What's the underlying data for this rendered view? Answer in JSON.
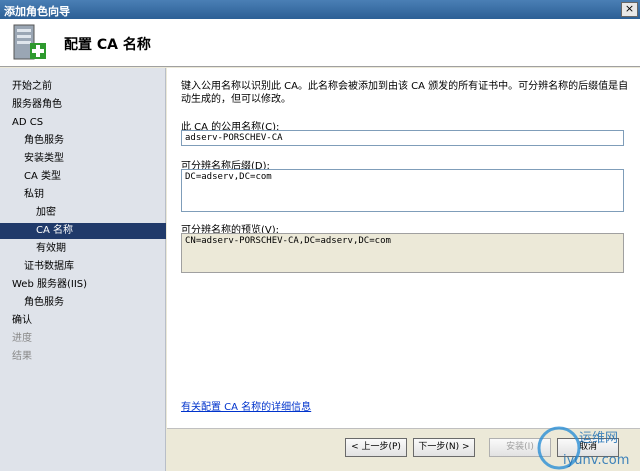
{
  "window": {
    "title": "添加角色向导",
    "close_label": "×"
  },
  "header": {
    "title": "配置 CA 名称",
    "icon": "server-certificate-icon"
  },
  "sidebar": {
    "items": [
      {
        "label": "开始之前",
        "state": "normal"
      },
      {
        "label": "服务器角色",
        "state": "normal"
      },
      {
        "label": "AD CS",
        "state": "normal"
      },
      {
        "label": "角色服务",
        "state": "normal"
      },
      {
        "label": "安装类型",
        "state": "normal"
      },
      {
        "label": "CA 类型",
        "state": "normal"
      },
      {
        "label": "私钥",
        "state": "normal"
      },
      {
        "label": "加密",
        "state": "normal"
      },
      {
        "label": "CA 名称",
        "state": "selected"
      },
      {
        "label": "有效期",
        "state": "normal"
      },
      {
        "label": "证书数据库",
        "state": "normal"
      },
      {
        "label": "Web 服务器(IIS)",
        "state": "normal"
      },
      {
        "label": "角色服务",
        "state": "normal"
      },
      {
        "label": "确认",
        "state": "normal"
      },
      {
        "label": "进度",
        "state": "disabled"
      },
      {
        "label": "结果",
        "state": "disabled"
      }
    ]
  },
  "main": {
    "description": "键入公用名称以识别此 CA。此名称会被添加到由该 CA 颁发的所有证书中。可分辨名称的后缀值是自动生成的，但可以修改。",
    "common_name_label": "此 CA 的公用名称(C):",
    "common_name_value": "adserv-PORSCHEV-CA",
    "dn_suffix_label": "可分辨名称后缀(D):",
    "dn_suffix_value": "DC=adserv,DC=com",
    "preview_label": "可分辨名称的预览(V):",
    "preview_value": "CN=adserv-PORSCHEV-CA,DC=adserv,DC=com",
    "help_link": "有关配置 CA 名称的详细信息"
  },
  "footer": {
    "back_label": "< 上一步(P)",
    "next_label": "下一步(N) >",
    "install_label": "安装(I)",
    "cancel_label": "取消"
  },
  "watermark": {
    "line1": "运维网",
    "line2": "iyunv.com"
  }
}
